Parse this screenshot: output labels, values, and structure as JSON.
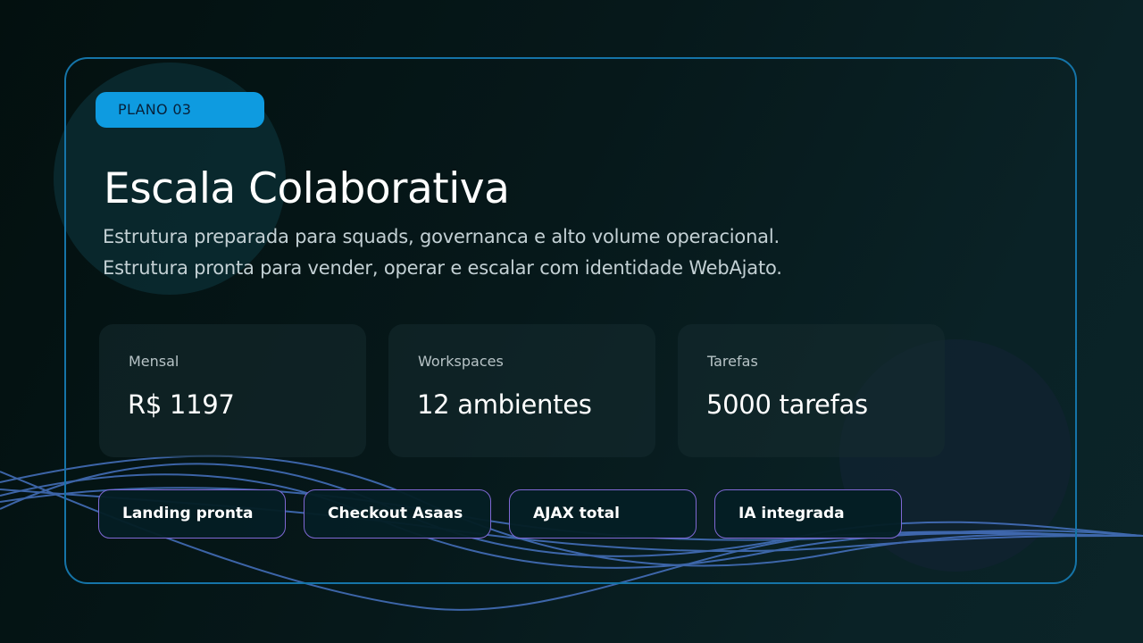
{
  "plan": {
    "badge": "PLANO 03",
    "title": "Escala Colaborativa",
    "description_lines": [
      "Estrutura preparada para squads, governanca e alto volume operacional.",
      "Estrutura pronta para vender, operar e escalar com identidade WebAjato."
    ]
  },
  "stats": [
    {
      "label": "Mensal",
      "value": "R$ 1197"
    },
    {
      "label": "Workspaces",
      "value": "12 ambientes"
    },
    {
      "label": "Tarefas",
      "value": "5000 tarefas"
    }
  ],
  "features": [
    "Landing pronta",
    "Checkout Asaas",
    "AJAX total",
    "IA integrada"
  ],
  "colors": {
    "accent": "#0e9be0",
    "card_border": "#1574a8",
    "tag_border": "#7f68d4",
    "wave": "#4f7fd8"
  }
}
